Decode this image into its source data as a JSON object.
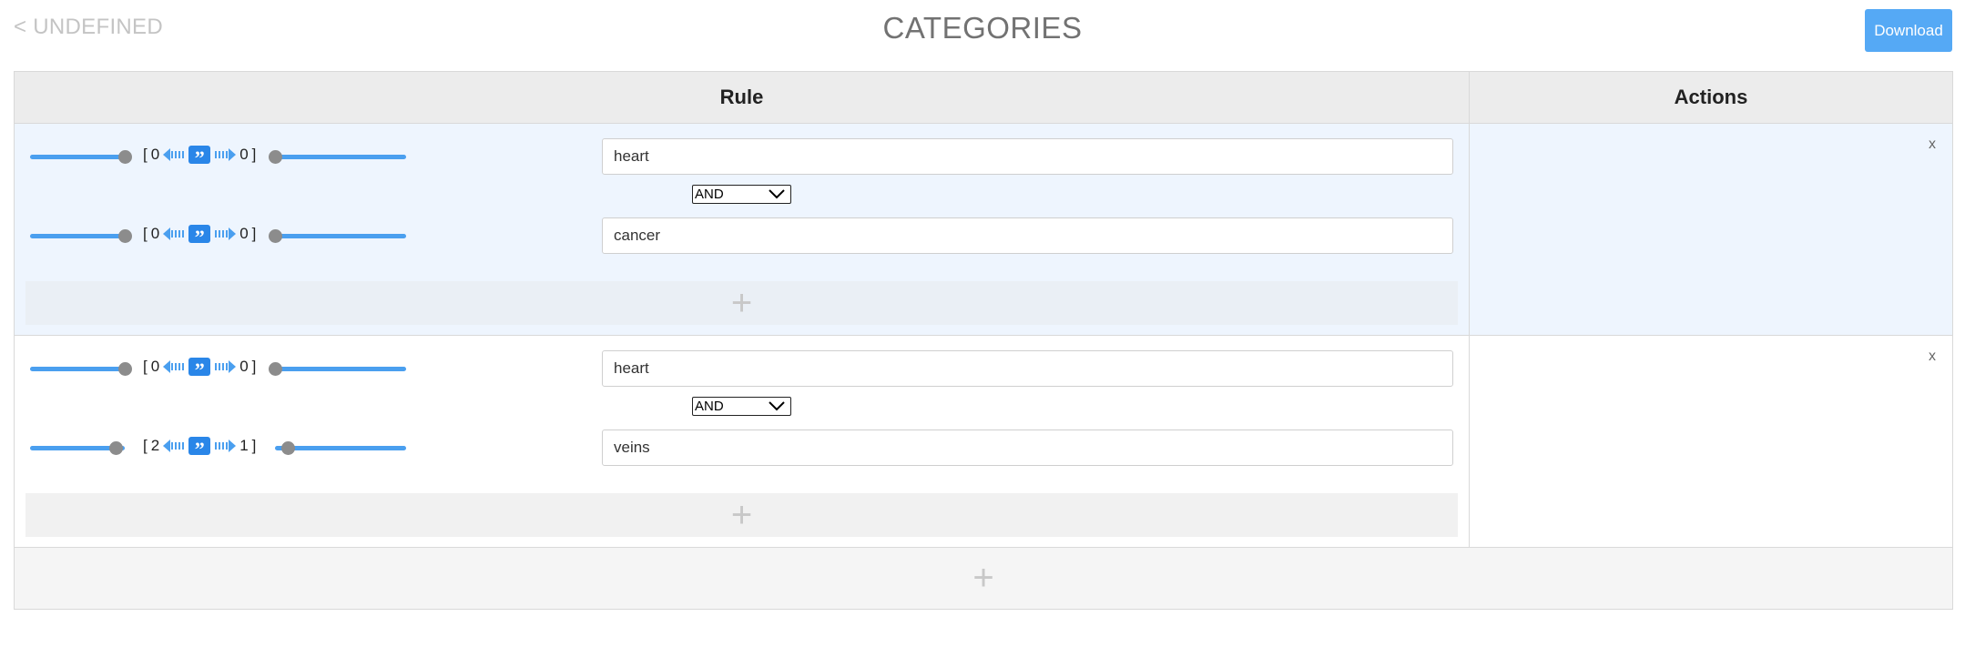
{
  "header": {
    "back_label": "< UNDEFINED",
    "title": "CATEGORIES",
    "download_label": "Download"
  },
  "table": {
    "columns": [
      "Rule",
      "Actions"
    ],
    "add_rule_label": "+",
    "rules": [
      {
        "remove_label": "x",
        "add_term_label": "+",
        "operator": "AND",
        "terms": [
          {
            "value": "heart",
            "left": "0",
            "right": "0",
            "left_slider_level": 1.0,
            "right_slider_level": 0.0
          },
          {
            "value": "cancer",
            "left": "0",
            "right": "0",
            "left_slider_level": 1.0,
            "right_slider_level": 0.0
          }
        ]
      },
      {
        "remove_label": "x",
        "add_term_label": "+",
        "operator": "AND",
        "terms": [
          {
            "value": "heart",
            "left": "0",
            "right": "0",
            "left_slider_level": 1.0,
            "right_slider_level": 0.0
          },
          {
            "value": "veins",
            "left": "2",
            "right": "1",
            "left_slider_level": 0.9,
            "right_slider_level": 0.1
          }
        ]
      }
    ]
  },
  "colors": {
    "accent": "#55a9f5",
    "slider_track": "#4a9fef",
    "quote_badge": "#2a86e8",
    "row_highlight": "#eef5fe"
  }
}
